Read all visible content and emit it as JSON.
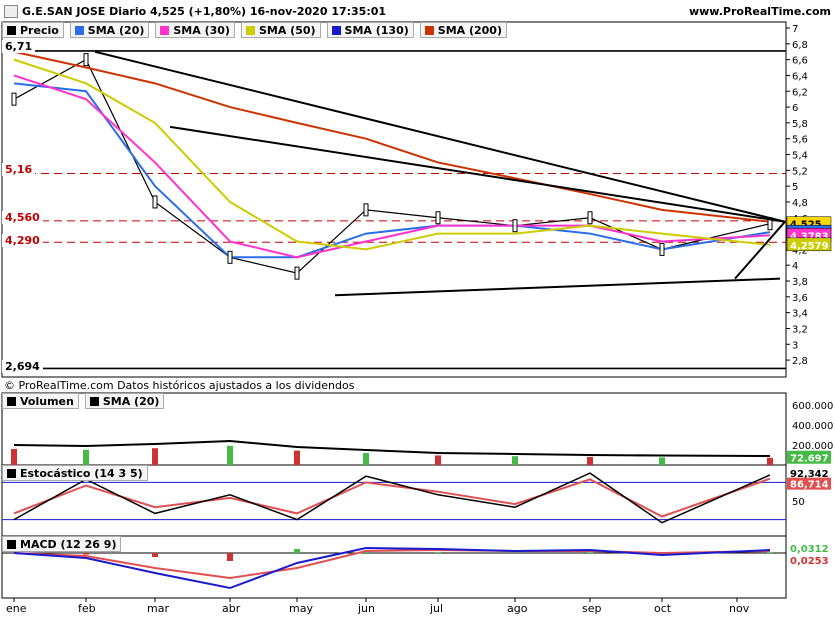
{
  "header": {
    "title": "G.E.SAN JOSE Diario 4,525 (+1,80%) 16-nov-2020 17:35:01",
    "website": "www.ProRealTime.com"
  },
  "price_panel": {
    "legend": [
      {
        "label": "Precio",
        "color": "#000000"
      },
      {
        "label": "SMA (20)",
        "color": "#2a6fe8"
      },
      {
        "label": "SMA (30)",
        "color": "#ff33cc"
      },
      {
        "label": "SMA (50)",
        "color": "#cccc00"
      },
      {
        "label": "SMA (130)",
        "color": "#1a1acc"
      },
      {
        "label": "SMA (200)",
        "color": "#cc3300"
      }
    ],
    "level_labels": {
      "top": "6,71",
      "l516": "5,16",
      "l456": "4,560",
      "l429": "4,290",
      "bottom": "2,694"
    },
    "right_tags": {
      "last": "4,525",
      "t1": "4,4178",
      "t2": "4,3783",
      "t3": "4,2579"
    },
    "yticks": [
      "7",
      "6,8",
      "6,6",
      "6,4",
      "6,2",
      "6",
      "5,8",
      "5,6",
      "5,4",
      "5,2",
      "5",
      "4,8",
      "4,6",
      "4,4",
      "4,2",
      "4",
      "3,8",
      "3,6",
      "3,4",
      "3,2",
      "3",
      "2,8"
    ],
    "footer": "© ProRealTime.com Datos históricos ajustados a los dividendos"
  },
  "volume_panel": {
    "legend": [
      {
        "label": "Volumen",
        "color": "#000000"
      },
      {
        "label": "SMA (20)",
        "color": "#000000"
      }
    ],
    "yticks": [
      "600.000",
      "400.000",
      "200.000"
    ],
    "value_tag": "72.697"
  },
  "stoch_panel": {
    "legend": [
      {
        "label": "Estocástico (14 3 5)",
        "color": "#000000"
      }
    ],
    "yticks": [
      "50"
    ],
    "tags": {
      "k": "92,342",
      "d": "86,714"
    }
  },
  "macd_panel": {
    "legend": [
      {
        "label": "MACD (12 26 9)",
        "color": "#000000"
      }
    ],
    "tags": {
      "a": "0,0312",
      "b": "0,0253"
    }
  },
  "xaxis": {
    "months": [
      "ene",
      "feb",
      "mar",
      "abr",
      "may",
      "jun",
      "jul",
      "ago",
      "sep",
      "oct",
      "nov"
    ]
  },
  "chart_data": {
    "type": "line",
    "title": "G.E.SAN JOSE Diario 4,525 (+1,80%) 16-nov-2020 17:35:01",
    "xlabel": "",
    "ylabel": "",
    "ylim": [
      2.7,
      7.0
    ],
    "x": [
      "ene",
      "feb",
      "mar",
      "abr",
      "may",
      "jun",
      "jul",
      "ago",
      "sep",
      "oct",
      "nov"
    ],
    "series": [
      {
        "name": "Precio",
        "values": [
          6.1,
          6.6,
          4.8,
          4.1,
          3.9,
          4.7,
          4.6,
          4.5,
          4.6,
          4.2,
          4.525
        ]
      },
      {
        "name": "SMA (20)",
        "values": [
          6.3,
          6.2,
          5.0,
          4.1,
          4.1,
          4.4,
          4.5,
          4.5,
          4.4,
          4.2,
          4.4178
        ]
      },
      {
        "name": "SMA (30)",
        "values": [
          6.4,
          6.1,
          5.3,
          4.3,
          4.1,
          4.3,
          4.5,
          4.5,
          4.5,
          4.3,
          4.3783
        ]
      },
      {
        "name": "SMA (50)",
        "values": [
          6.6,
          6.3,
          5.8,
          4.8,
          4.3,
          4.2,
          4.4,
          4.4,
          4.5,
          4.4,
          4.2579
        ]
      },
      {
        "name": "SMA (200)",
        "values": [
          6.7,
          6.5,
          6.3,
          6.0,
          5.8,
          5.6,
          5.3,
          5.1,
          4.9,
          4.7,
          4.55
        ]
      }
    ],
    "reference_levels": [
      6.71,
      5.16,
      4.56,
      4.29,
      2.694
    ]
  }
}
